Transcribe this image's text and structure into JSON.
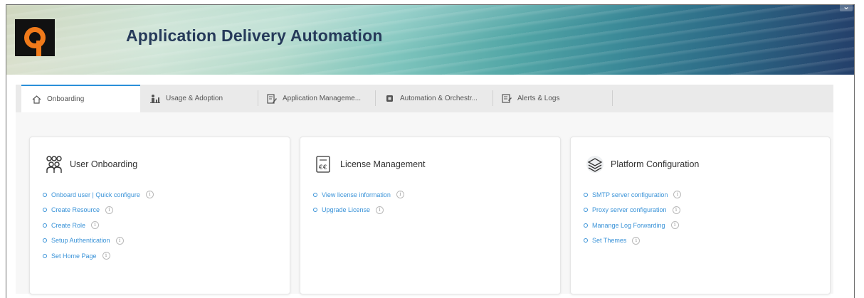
{
  "header": {
    "app_title": "Application Delivery Automation",
    "logo_letter": "a",
    "brand_color": "#f07a1a"
  },
  "tabs": [
    {
      "label": "Onboarding",
      "icon": "home-icon",
      "active": true
    },
    {
      "label": "Usage & Adoption",
      "icon": "people-chart-icon",
      "active": false
    },
    {
      "label": "Application Manageme...",
      "icon": "edit-document-icon",
      "active": false
    },
    {
      "label": "Automation & Orchestr...",
      "icon": "chip-icon",
      "active": false
    },
    {
      "label": "Alerts & Logs",
      "icon": "log-icon",
      "active": false
    }
  ],
  "cards": [
    {
      "title": "User Onboarding",
      "icon": "users-group-icon",
      "links": [
        "Onboard user | Quick configure",
        "Create Resource",
        "Create Role",
        "Setup Authentication",
        "Set Home Page"
      ]
    },
    {
      "title": "License Management",
      "icon": "license-icon",
      "links": [
        "View license information",
        "Upgrade License"
      ]
    },
    {
      "title": "Platform Configuration",
      "icon": "layers-icon",
      "links": [
        "SMTP server configuration",
        "Proxy server configuration",
        "Manange Log Forwarding",
        "Set Themes"
      ]
    }
  ],
  "info_glyph": "i",
  "colors": {
    "link": "#3a93d8",
    "active_tab_accent": "#2b8fd9",
    "title": "#263a5a"
  }
}
